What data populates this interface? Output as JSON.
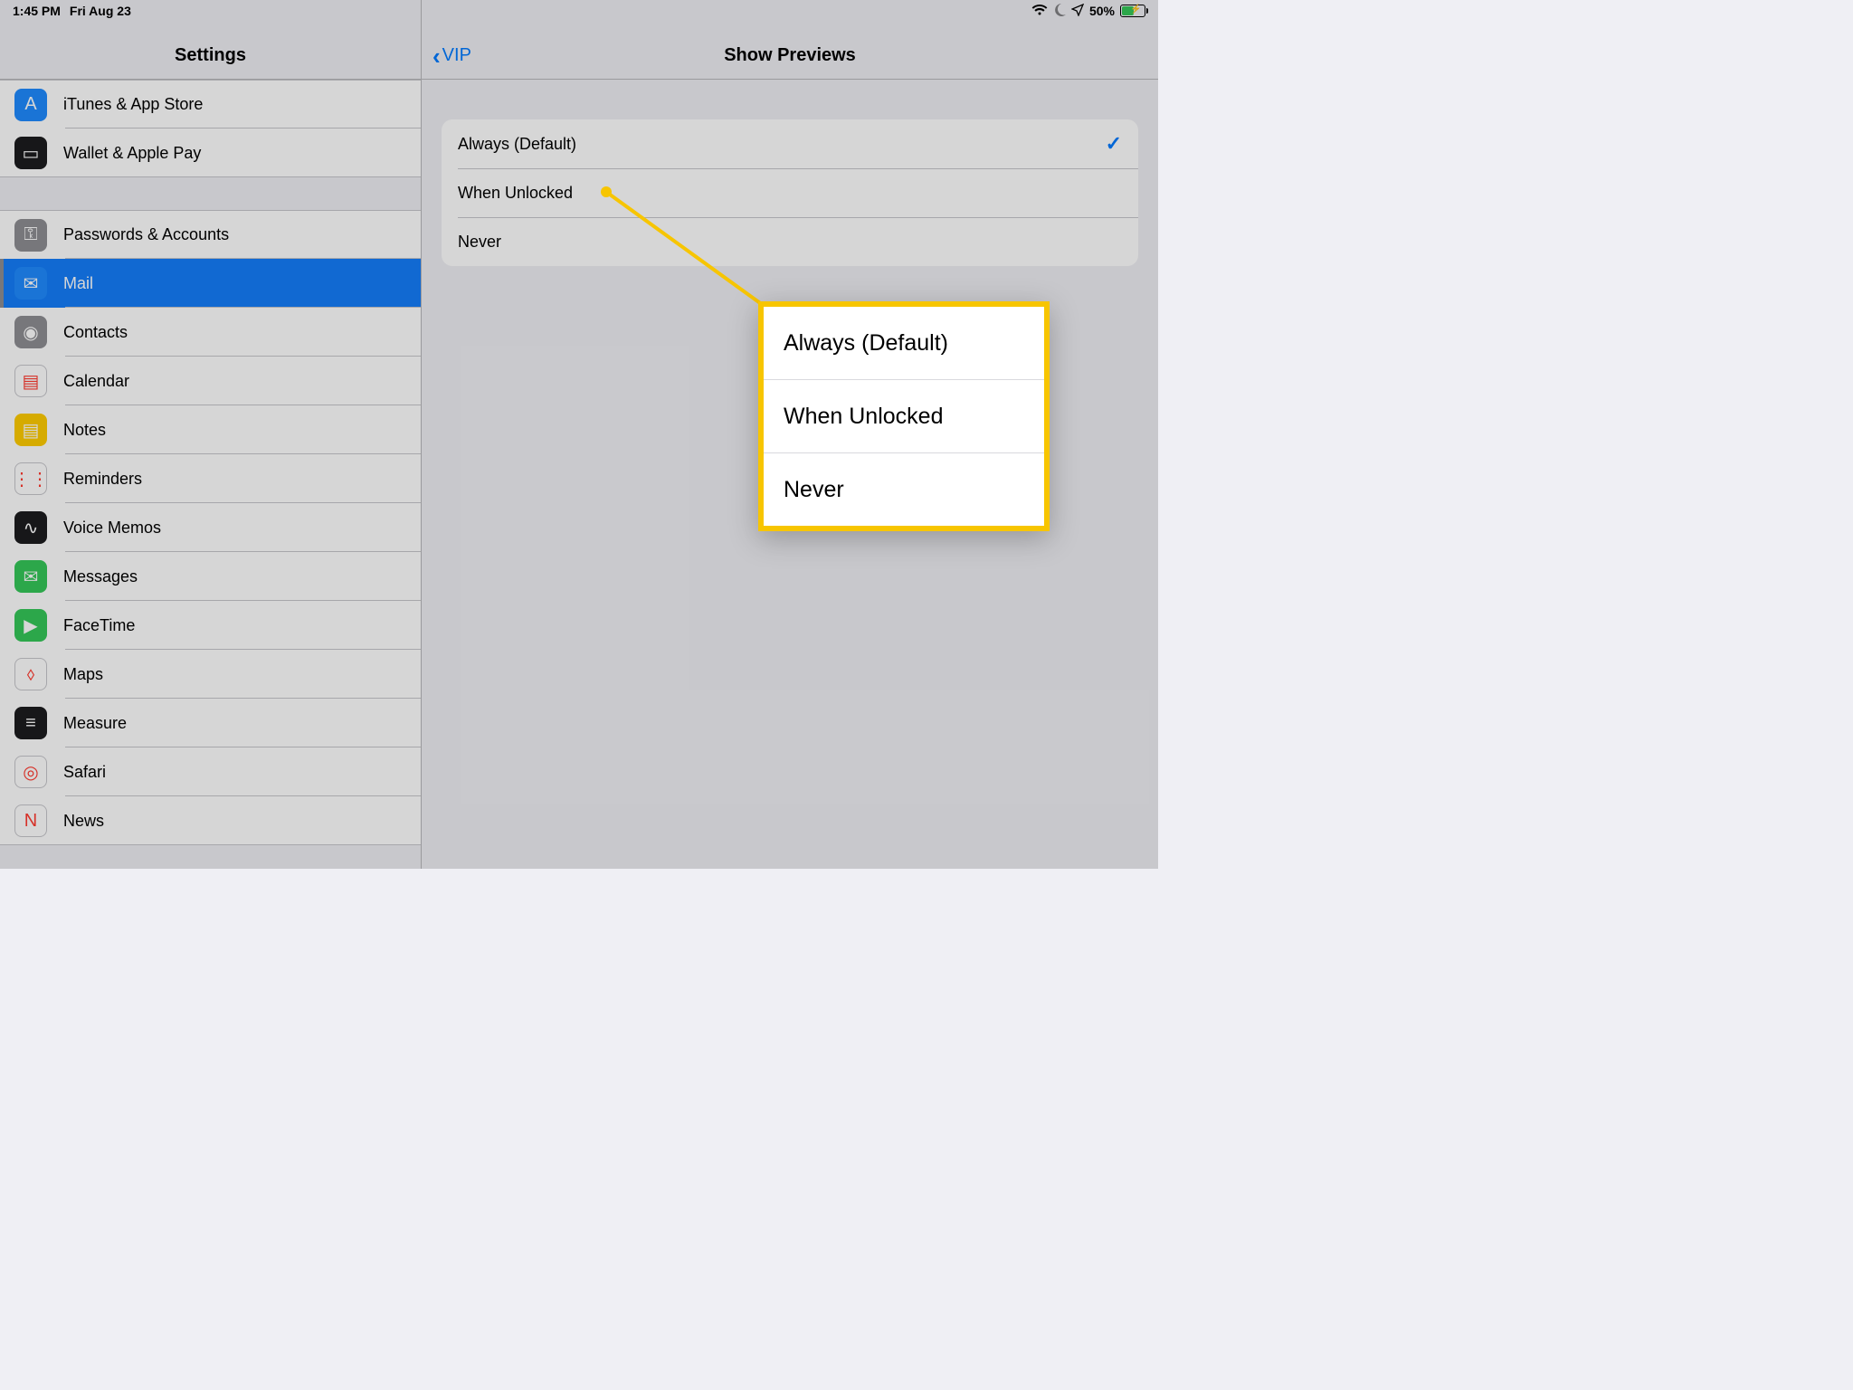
{
  "status_bar": {
    "time": "1:45 PM",
    "date": "Fri Aug 23",
    "battery_pct": "50%"
  },
  "sidebar": {
    "title": "Settings",
    "groups": [
      [
        {
          "id": "itunes",
          "label": "iTunes & App Store",
          "icon": "appstore"
        },
        {
          "id": "wallet",
          "label": "Wallet & Apple Pay",
          "icon": "wallet"
        }
      ],
      [
        {
          "id": "passwords",
          "label": "Passwords & Accounts",
          "icon": "key"
        },
        {
          "id": "mail",
          "label": "Mail",
          "icon": "mail",
          "selected": true
        },
        {
          "id": "contacts",
          "label": "Contacts",
          "icon": "contacts"
        },
        {
          "id": "calendar",
          "label": "Calendar",
          "icon": "calendar"
        },
        {
          "id": "notes",
          "label": "Notes",
          "icon": "notes"
        },
        {
          "id": "reminders",
          "label": "Reminders",
          "icon": "reminders"
        },
        {
          "id": "voicememos",
          "label": "Voice Memos",
          "icon": "voicememos"
        },
        {
          "id": "messages",
          "label": "Messages",
          "icon": "messages"
        },
        {
          "id": "facetime",
          "label": "FaceTime",
          "icon": "facetime"
        },
        {
          "id": "maps",
          "label": "Maps",
          "icon": "maps"
        },
        {
          "id": "measure",
          "label": "Measure",
          "icon": "measure"
        },
        {
          "id": "safari",
          "label": "Safari",
          "icon": "safari"
        },
        {
          "id": "news",
          "label": "News",
          "icon": "news"
        }
      ]
    ]
  },
  "detail": {
    "back_label": "VIP",
    "title": "Show Previews",
    "options": [
      {
        "label": "Always (Default)",
        "selected": true
      },
      {
        "label": "When Unlocked",
        "selected": false
      },
      {
        "label": "Never",
        "selected": false
      }
    ]
  },
  "callout": {
    "items": [
      "Always (Default)",
      "When Unlocked",
      "Never"
    ]
  },
  "icon_colors": {
    "appstore": "#1f8bff",
    "wallet": "#1c1c1e",
    "key": "#8e8e93",
    "mail": "#1f8bff",
    "contacts": "#8e8e93",
    "calendar": "#ffffff",
    "notes": "#ffcc00",
    "reminders": "#ffffff",
    "voicememos": "#1c1c1e",
    "messages": "#35c759",
    "facetime": "#35c759",
    "maps": "#ffffff",
    "measure": "#1c1c1e",
    "safari": "#ffffff",
    "news": "#ffffff"
  },
  "icon_glyphs": {
    "appstore": "A",
    "wallet": "▭",
    "key": "⚿",
    "mail": "✉",
    "contacts": "◉",
    "calendar": "▤",
    "notes": "▤",
    "reminders": "⋮⋮",
    "voicememos": "∿",
    "messages": "✉",
    "facetime": "▶",
    "maps": "⬨",
    "measure": "≡",
    "safari": "◎",
    "news": "N"
  }
}
